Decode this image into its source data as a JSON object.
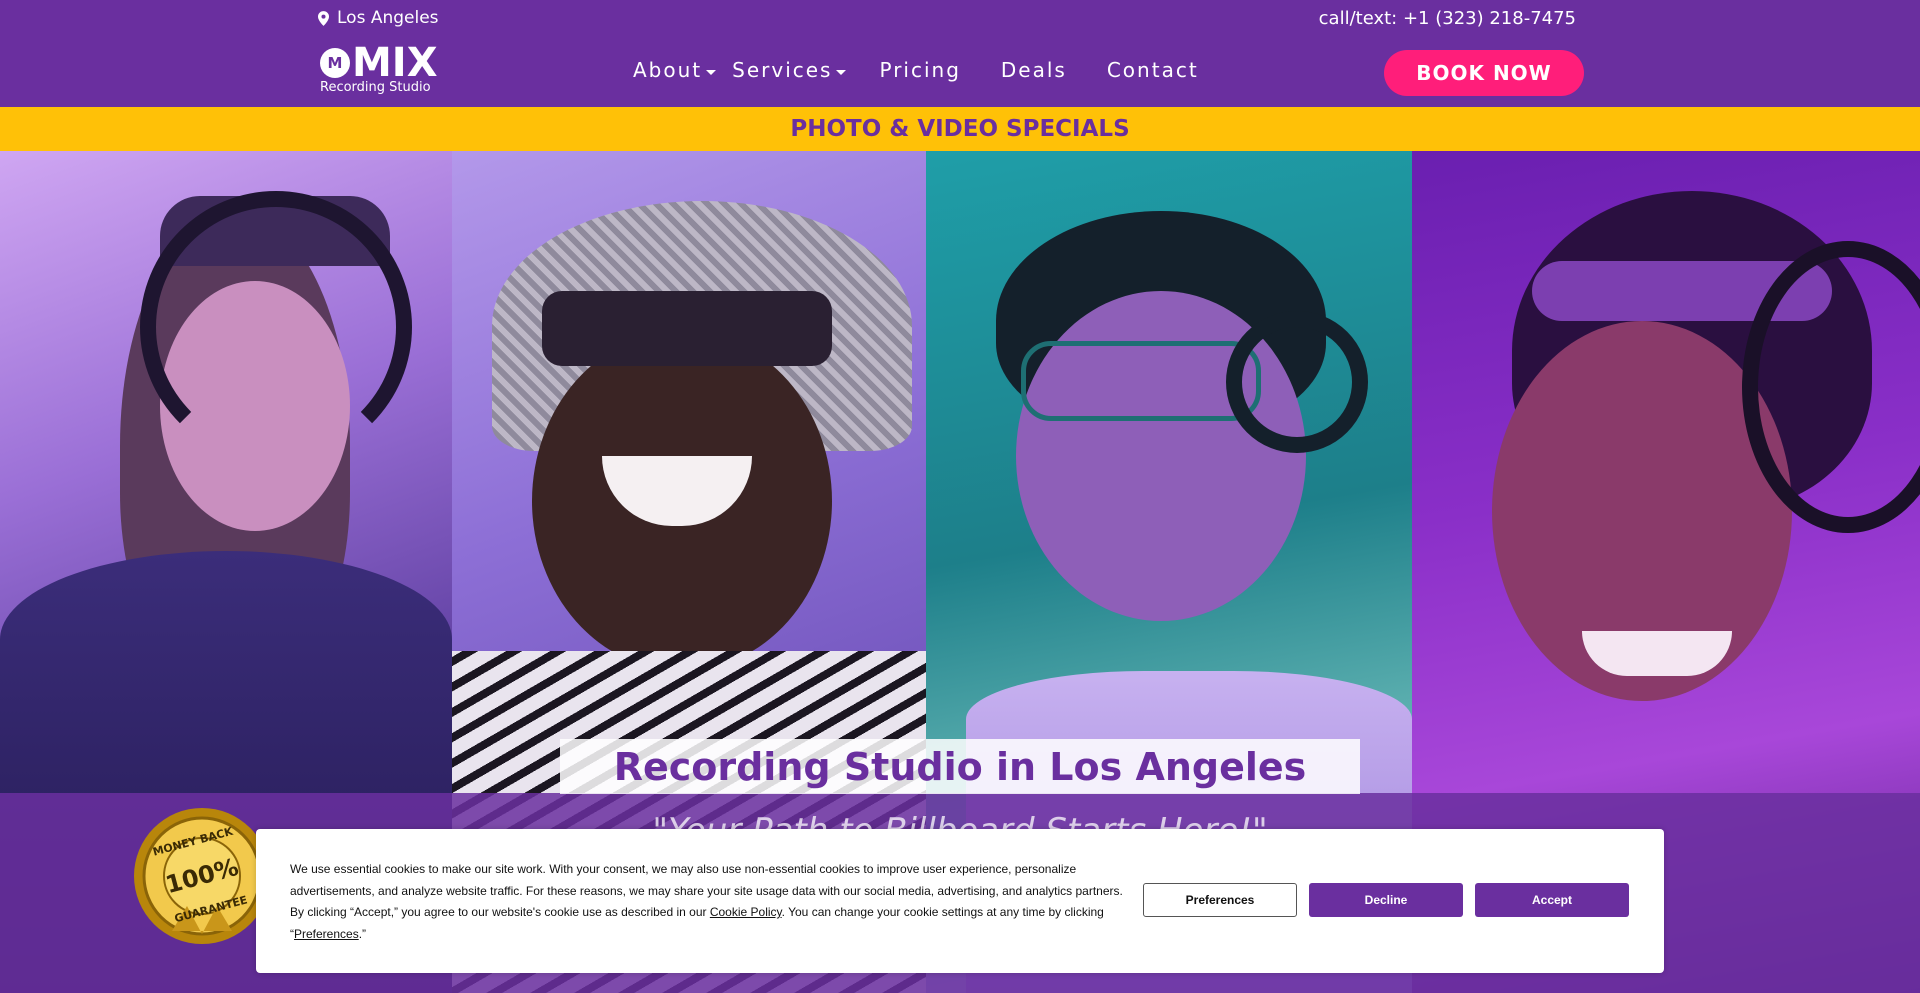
{
  "header": {
    "location": "Los Angeles",
    "phone": "call/text: +1 (323) 218-7475",
    "logo_word": "MIX",
    "logo_sub": "Recording Studio",
    "nav": [
      "About",
      "Services",
      "Pricing",
      "Deals",
      "Contact"
    ],
    "book_label": "BOOK NOW"
  },
  "promo": {
    "label": "PHOTO & VIDEO SPECIALS"
  },
  "hero": {
    "title": "Recording Studio in Los Angeles",
    "subtitle": "\"Your Path to Billboard Starts Here!\"",
    "badge": {
      "top": "MONEY BACK",
      "center": "100%",
      "bottom": "GUARANTEE"
    }
  },
  "cookie": {
    "text_1": "We use essential cookies to make our site work. With your consent, we may also use non-essential cookies to improve user experience, personalize advertisements, and analyze website traffic. For these reasons, we may share your site usage data with our social media, advertising, and analytics partners. By clicking “Accept,” you agree to our website's cookie use as described in our ",
    "policy_link": "Cookie Policy",
    "text_2": ". You can change your cookie settings at any time by clicking “",
    "prefs_link": "Preferences",
    "text_3": ".”",
    "preferences_label": "Preferences",
    "decline_label": "Decline",
    "accept_label": "Accept"
  },
  "colors": {
    "brand_purple": "#6a2f9f",
    "promo_yellow": "#ffc107",
    "book_pink": "#ff1e7a"
  },
  "icons": {
    "location": "location-pin-icon",
    "dropdown": "caret-down-icon",
    "badge": "guarantee-seal-icon"
  }
}
